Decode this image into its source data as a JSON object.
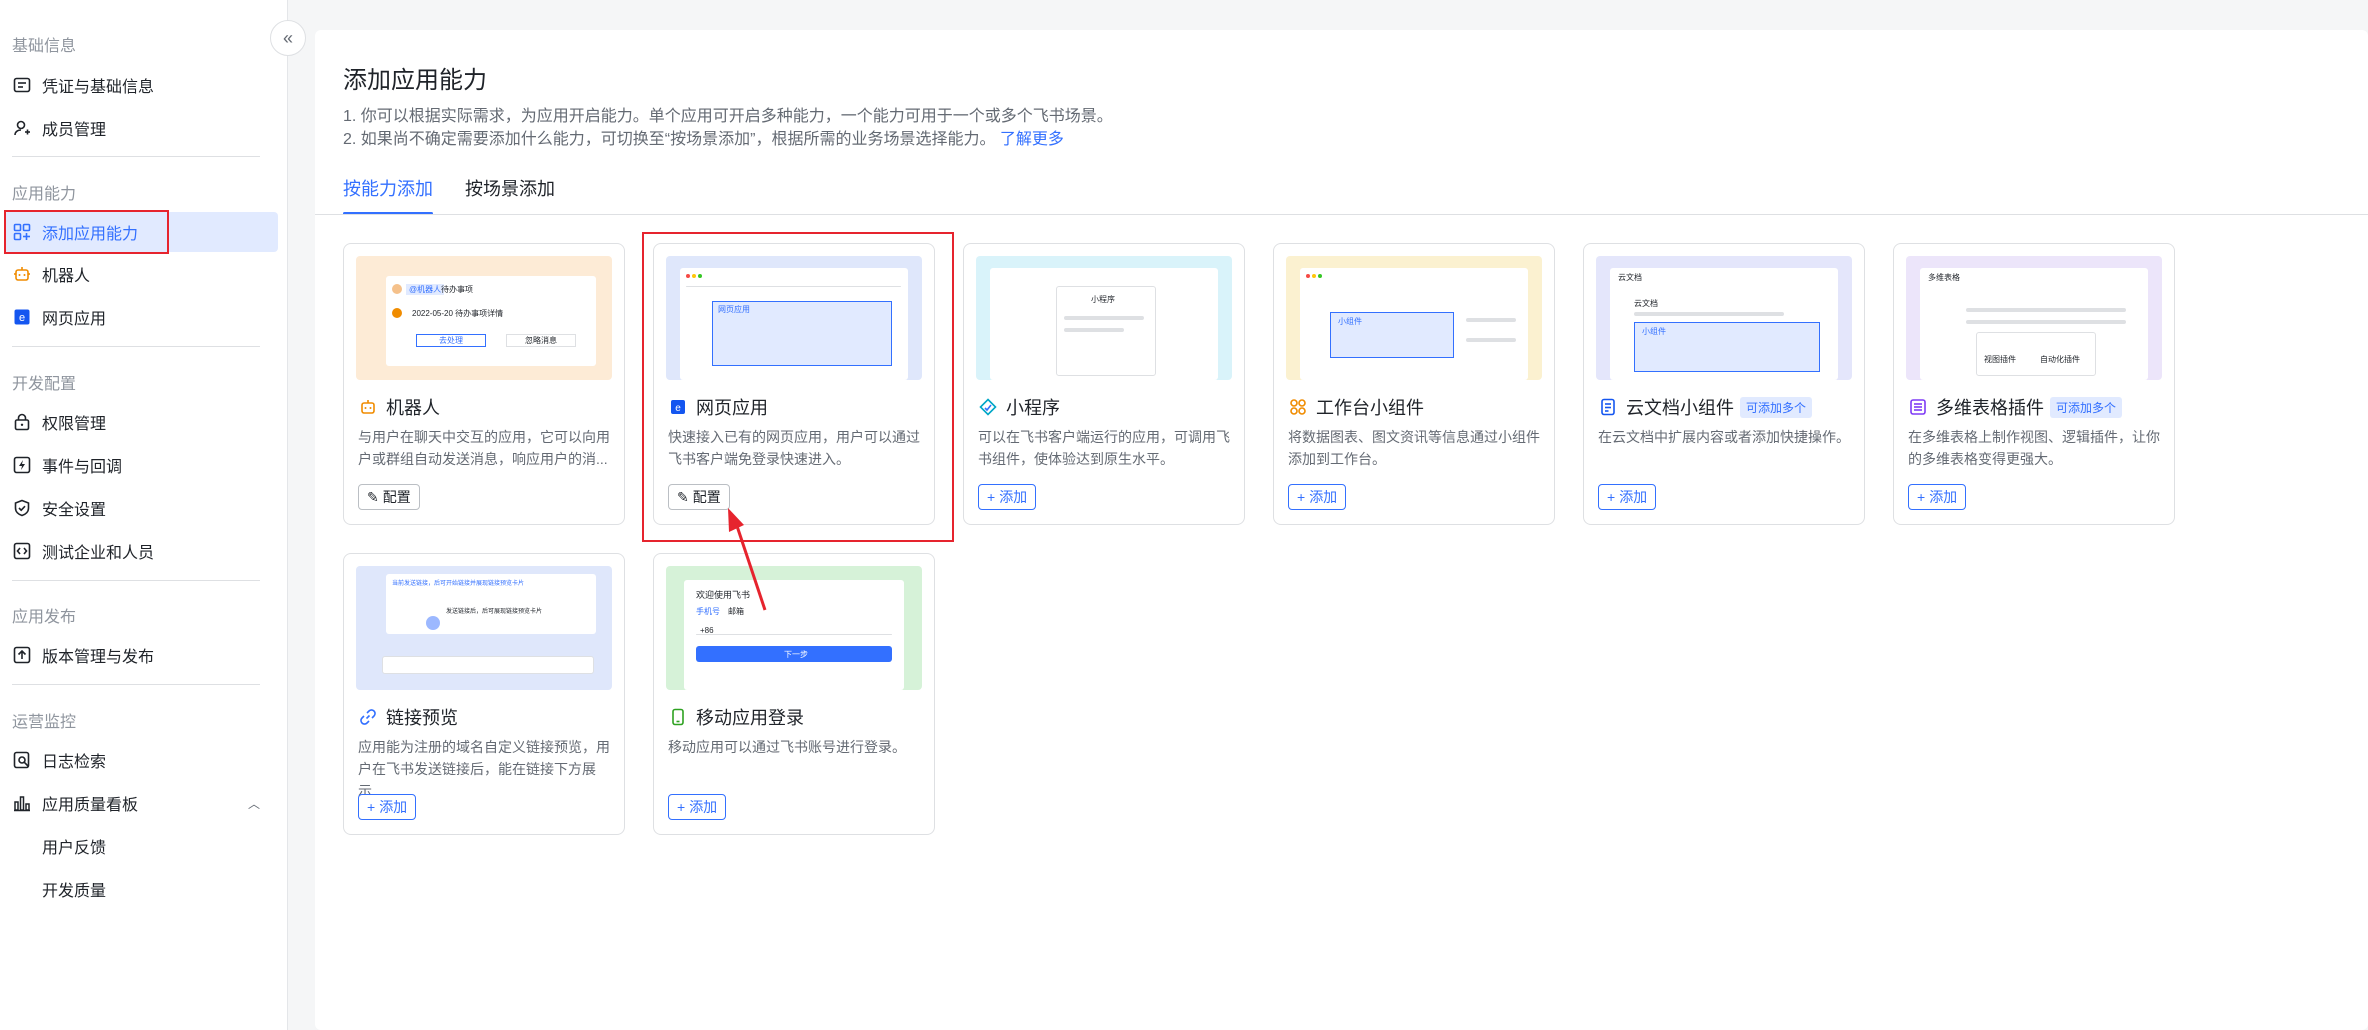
{
  "sidebar": {
    "collapse_icon": "«",
    "groups": [
      {
        "title": "基础信息",
        "items": [
          {
            "label": "凭证与基础信息",
            "icon": "id-card-icon"
          },
          {
            "label": "成员管理",
            "icon": "add-member-icon"
          }
        ]
      },
      {
        "title": "应用能力",
        "items": [
          {
            "label": "添加应用能力",
            "icon": "grid-add-icon",
            "active": true
          },
          {
            "label": "机器人",
            "icon": "robot-icon"
          },
          {
            "label": "网页应用",
            "icon": "web-app-icon"
          }
        ]
      },
      {
        "title": "开发配置",
        "items": [
          {
            "label": "权限管理",
            "icon": "lock-icon"
          },
          {
            "label": "事件与回调",
            "icon": "event-icon"
          },
          {
            "label": "安全设置",
            "icon": "shield-icon"
          },
          {
            "label": "测试企业和人员",
            "icon": "code-icon"
          }
        ]
      },
      {
        "title": "应用发布",
        "items": [
          {
            "label": "版本管理与发布",
            "icon": "upload-icon"
          }
        ]
      },
      {
        "title": "运营监控",
        "items": [
          {
            "label": "日志检索",
            "icon": "log-search-icon"
          },
          {
            "label": "应用质量看板",
            "icon": "bar-chart-icon"
          },
          {
            "label": "用户反馈",
            "icon": ""
          },
          {
            "label": "开发质量",
            "icon": ""
          }
        ]
      }
    ]
  },
  "main": {
    "title": "添加应用能力",
    "desc1": "1. 你可以根据实际需求，为应用开启能力。单个应用可开启多种能力，一个能力可用于一个或多个飞书场景。",
    "desc2": "2. 如果尚不确定需要添加什么能力，可切换至“按场景添加”，根据所需的业务场景选择能力。",
    "learn_more": "了解更多",
    "tabs": [
      {
        "label": "按能力添加",
        "active": true
      },
      {
        "label": "按场景添加",
        "active": false
      }
    ],
    "cards": [
      {
        "title": "机器人",
        "desc": "与用户在聊天中交互的应用，它可以向用户或群组自动发送消息，响应用户的消...",
        "button": "配置",
        "badge": ""
      },
      {
        "title": "网页应用",
        "desc": "快速接入已有的网页应用，用户可以通过飞书客户端免登录快速进入。",
        "button": "配置",
        "badge": ""
      },
      {
        "title": "小程序",
        "desc": "可以在飞书客户端运行的应用，可调用飞书组件，使体验达到原生水平。",
        "button": "添加",
        "badge": ""
      },
      {
        "title": "工作台小组件",
        "desc": "将数据图表、图文资讯等信息通过小组件添加到工作台。",
        "button": "添加",
        "badge": ""
      },
      {
        "title": "云文档小组件",
        "desc": "在云文档中扩展内容或者添加快捷操作。",
        "button": "添加",
        "badge": "可添加多个"
      },
      {
        "title": "多维表格插件",
        "desc": "在多维表格上制作视图、逻辑插件，让你的多维表格变得更强大。",
        "button": "添加",
        "badge": "可添加多个"
      },
      {
        "title": "链接预览",
        "desc": "应用能为注册的域名自定义链接预览，用户在飞书发送链接后，能在链接下方展示...",
        "button": "添加",
        "badge": ""
      },
      {
        "title": "移动应用登录",
        "desc": "移动应用可以通过飞书账号进行登录。",
        "button": "添加",
        "badge": ""
      }
    ],
    "thumbs": {
      "robot_tag": "@机器人",
      "robot_msg": "待办事项",
      "robot_date": "2022-05-20 待办事项详情",
      "robot_btn1": "去处理",
      "robot_btn2": "忽略消息",
      "web_app_label": "网页应用",
      "miniprogram_label": "小程序",
      "widget_label": "小组件",
      "doc_title": "云文档",
      "doc_h": "云文档",
      "doc_widget": "小组件",
      "base_title": "多维表格",
      "base_view": "视图插件",
      "base_auto": "自动化插件",
      "login_title": "欢迎使用飞书",
      "login_tab1": "手机号",
      "login_tab2": "邮箱",
      "login_code": "+86",
      "login_next": "下一步",
      "link_msg": "当前发送链接，后可开始链接并展现链接预览卡片",
      "link_msg2": "发送链接后，后可展现链接预览卡片"
    }
  },
  "colors": {
    "accent": "#3370ff",
    "highlight": "#e6242e"
  }
}
